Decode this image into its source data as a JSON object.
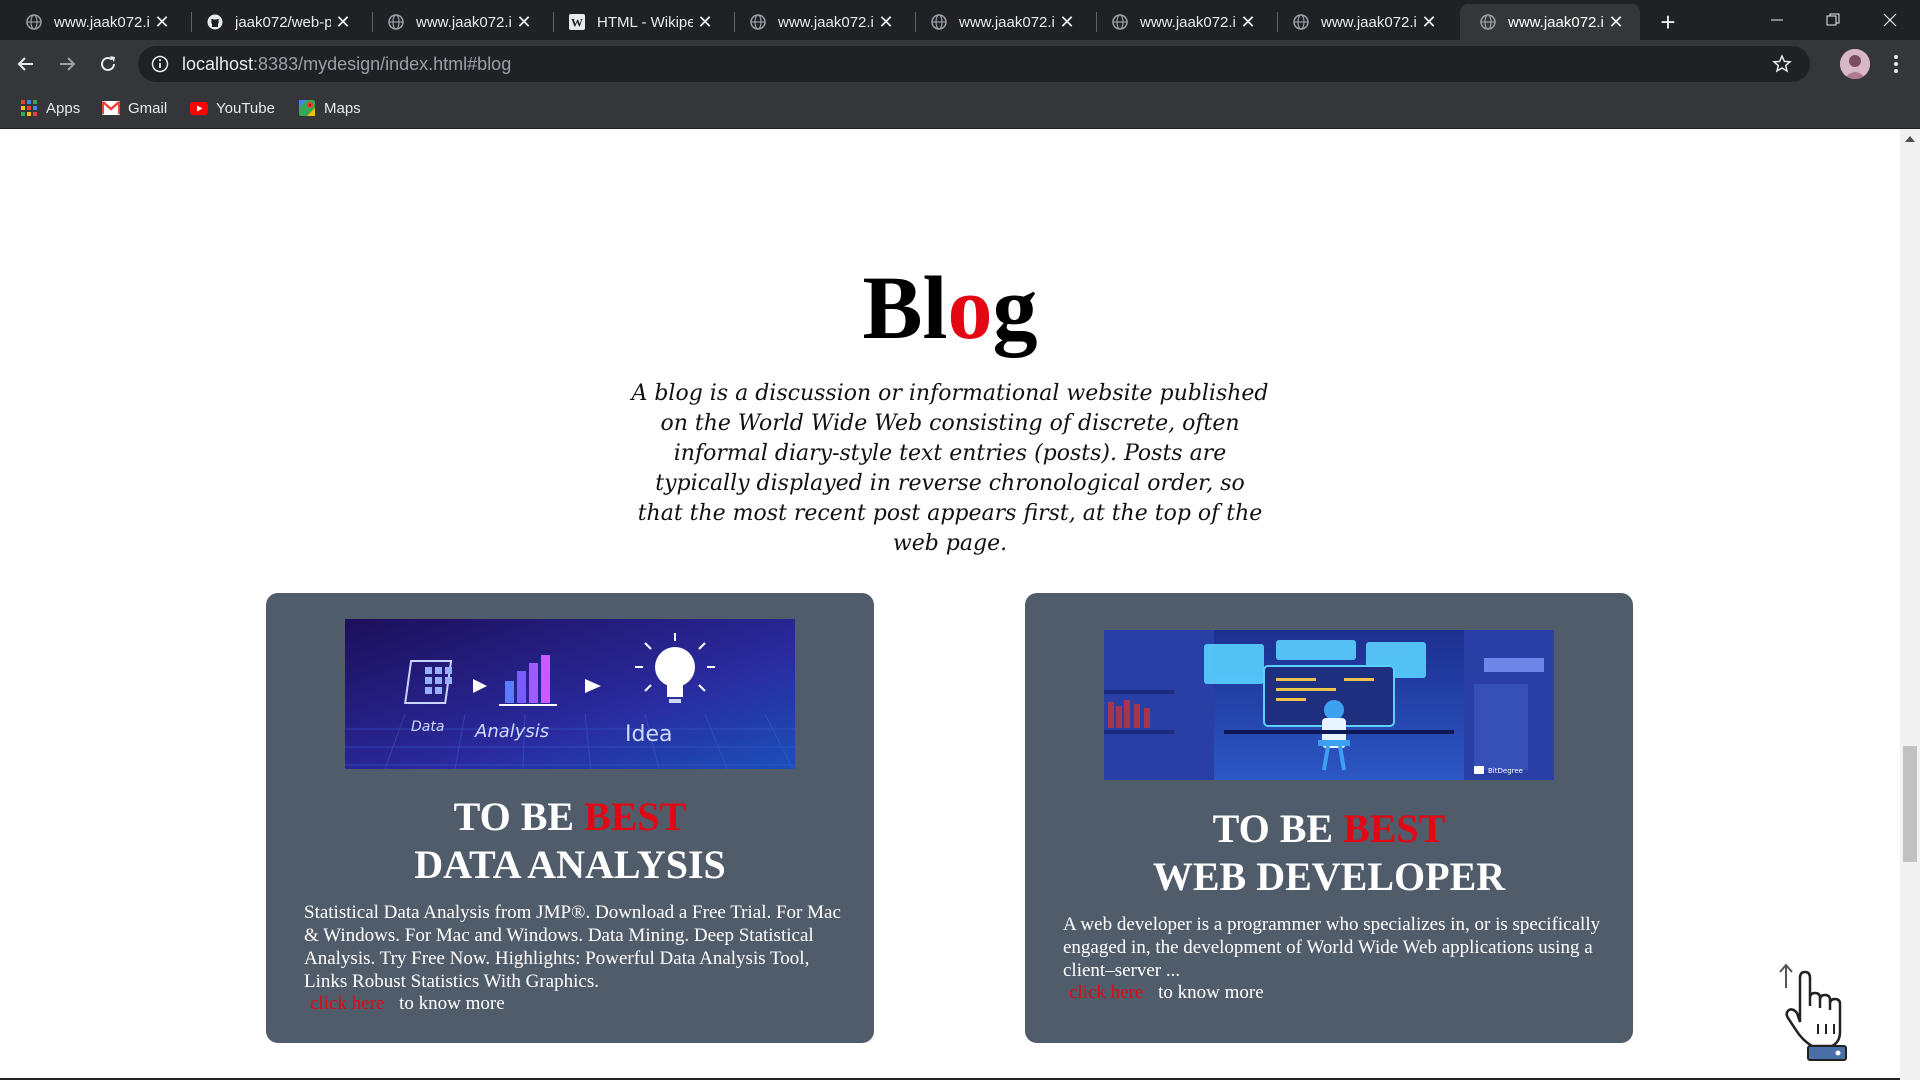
{
  "tabs": [
    {
      "title": "www.jaak072.in",
      "icon": "globe-icon"
    },
    {
      "title": "jaak072/web-p",
      "icon": "github-icon"
    },
    {
      "title": "www.jaak072.in",
      "icon": "globe-icon"
    },
    {
      "title": "HTML - Wikipe",
      "icon": "wikipedia-icon"
    },
    {
      "title": "www.jaak072.in",
      "icon": "globe-icon"
    },
    {
      "title": "www.jaak072.in",
      "icon": "globe-icon"
    },
    {
      "title": "www.jaak072.in",
      "icon": "globe-icon"
    },
    {
      "title": "www.jaak072.in",
      "icon": "globe-icon"
    },
    {
      "title": "www.jaak072.in",
      "icon": "globe-icon",
      "active": true
    }
  ],
  "omnibox": {
    "host": "localhost",
    "rest": ":8383/mydesign/index.html#blog"
  },
  "bookmarks": [
    {
      "label": "Apps",
      "icon": "apps-grid-icon"
    },
    {
      "label": "Gmail",
      "icon": "gmail-icon"
    },
    {
      "label": "YouTube",
      "icon": "youtube-icon"
    },
    {
      "label": "Maps",
      "icon": "maps-icon"
    }
  ],
  "blog": {
    "title_pre": "Bl",
    "title_accent": "o",
    "title_post": "g",
    "description": "A blog is a discussion or informational website published on the World Wide Web consisting of discrete, often informal diary-style text entries (posts). Posts are typically displayed in reverse chronological order, so that the most recent post appears first, at the top of the web page."
  },
  "cards": [
    {
      "head_pre": "TO BE ",
      "head_accent": "BEST",
      "head_line2": "DATA  ANALYSIS",
      "image_labels": [
        "Data",
        "Analysis",
        "Idea"
      ],
      "body": "Statistical Data Analysis from JMP®. Download a Free Trial. For Mac & Windows. For Mac and Windows. Data Mining. Deep Statistical Analysis. Try Free Now. Highlights: Powerful Data Analysis Tool, Links Robust Statistics With Graphics.",
      "link_label": "click here",
      "link_suffix": "to know more"
    },
    {
      "head_pre": "TO BE ",
      "head_accent": "BEST",
      "head_line2": "WEB  DEVELOPER",
      "image_labels": [
        "BitDegree"
      ],
      "body": "A web developer is a programmer who specializes in, or is specifically engaged in, the development of World Wide Web applications using a client–server ...",
      "link_label": "click here",
      "link_suffix": "to know more"
    }
  ],
  "colors": {
    "accent": "#e30613",
    "card_bg": "#515c6b",
    "chrome_dark": "#202124",
    "chrome": "#35363a"
  }
}
